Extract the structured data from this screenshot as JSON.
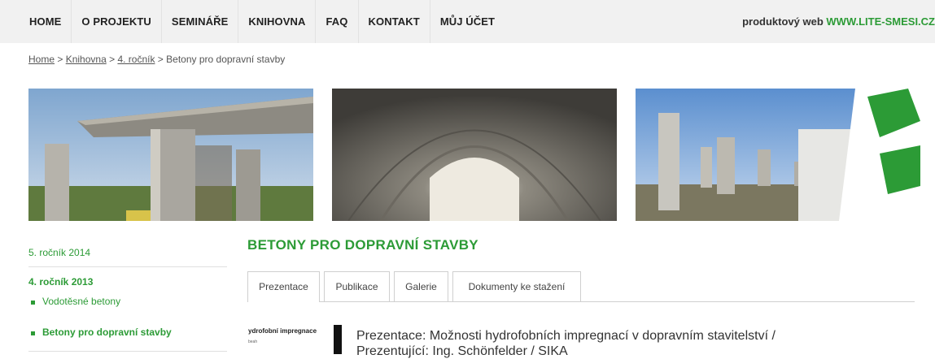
{
  "nav": {
    "items": [
      "HOME",
      "O PROJEKTU",
      "SEMINÁŘE",
      "KNIHOVNA",
      "FAQ",
      "KONTAKT",
      "MŮJ ÚČET"
    ],
    "promo_prefix": "produktový web ",
    "promo_site": "WWW.LITE-SMESI.CZ"
  },
  "breadcrumb": {
    "home": "Home",
    "sep1": " > ",
    "library": "Knihovna",
    "sep2": " > ",
    "year": "4. ročník",
    "sep3": " > ",
    "current": "Betony pro dopravní stavby"
  },
  "sidebar": {
    "year5": "5. ročník 2014",
    "year4": "4. ročník 2013",
    "sub1": "Vodotěsné betony",
    "sub2": "Betony pro dopravní stavby"
  },
  "main": {
    "heading": "BETONY PRO DOPRAVNÍ STAVBY",
    "tabs": [
      "Prezentace",
      "Publikace",
      "Galerie",
      "Dokumenty ke stažení"
    ],
    "item": {
      "thumb_title": "ydrofobní impregnace",
      "thumb_sub": "beah",
      "title_line1": "Prezentace: Možnosti hydrofobních impregnací v dopravním stavitelství /",
      "title_line2": "Prezentující: Ing. Schönfelder / SIKA"
    }
  },
  "colors": {
    "accent": "#2c9b36",
    "nav_bg": "#f1f1f1"
  }
}
